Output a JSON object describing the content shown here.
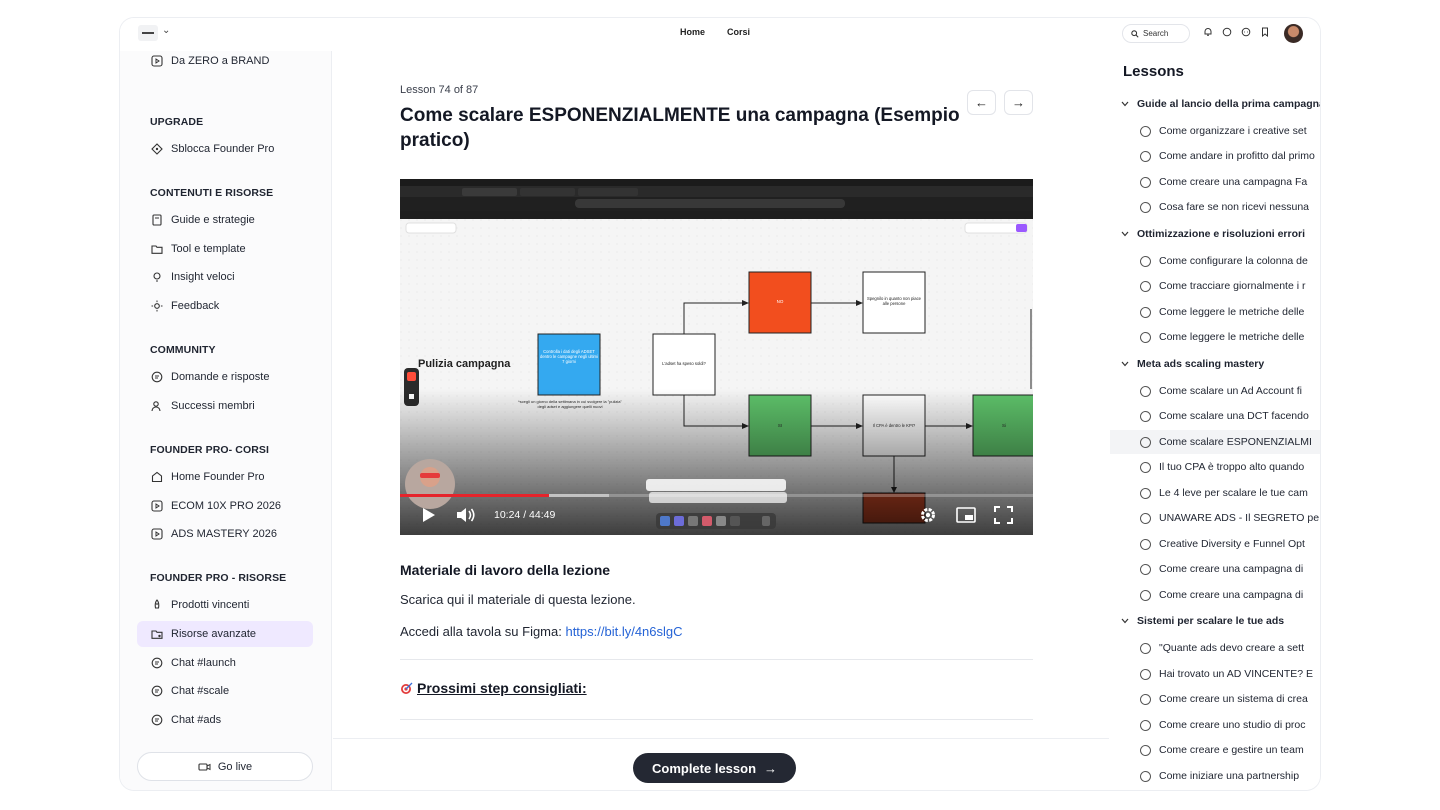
{
  "topbar": {
    "nav": [
      "Home",
      "Corsi"
    ],
    "search_label": "Search"
  },
  "sidebar": {
    "top_item": "Da ZERO a BRAND",
    "sections": [
      {
        "heading": "UPGRADE",
        "items": [
          {
            "label": "Sblocca Founder Pro",
            "icon": "diamond-icon"
          }
        ]
      },
      {
        "heading": "CONTENUTI E RISORSE",
        "items": [
          {
            "label": "Guide e strategie",
            "icon": "book-icon"
          },
          {
            "label": "Tool e template",
            "icon": "folder-icon"
          },
          {
            "label": "Insight veloci",
            "icon": "lightbulb-icon"
          },
          {
            "label": "Feedback",
            "icon": "sun-icon"
          }
        ]
      },
      {
        "heading": "COMMUNITY",
        "items": [
          {
            "label": "Domande e risposte",
            "icon": "chat-icon"
          },
          {
            "label": "Successi membri",
            "icon": "user-icon"
          }
        ]
      },
      {
        "heading": "FOUNDER PRO- CORSI",
        "items": [
          {
            "label": "Home Founder Pro",
            "icon": "home-icon"
          },
          {
            "label": "ECOM 10X PRO 2026",
            "icon": "play-square-icon"
          },
          {
            "label": "ADS MASTERY 2026",
            "icon": "play-square-icon"
          }
        ]
      },
      {
        "heading": "FOUNDER PRO - RISORSE",
        "items": [
          {
            "label": "Prodotti vincenti",
            "icon": "rocket-icon"
          },
          {
            "label": "Risorse avanzate",
            "icon": "folder-user-icon"
          },
          {
            "label": "Chat #launch",
            "icon": "chat-icon"
          },
          {
            "label": "Chat #scale",
            "icon": "chat-icon"
          },
          {
            "label": "Chat #ads",
            "icon": "chat-icon"
          }
        ]
      }
    ],
    "go_live": "Go live"
  },
  "main": {
    "lesson_count": "Lesson 74 of 87",
    "title": "Come scalare ESPONENZIALMENTE una campagna (Esempio pratico)",
    "video": {
      "time": "10:24 / 44:49",
      "progress": 0.235,
      "buffer": 0.33,
      "canvas_label": "Pulizia campagna",
      "node_blue": "Controlla i dati degli ADSET dentro le campagne negli ultimi 7 giorni",
      "node_note": "*scegli un giorno della settimana in cui svolgere la \"pulizia\" degli adset e aggiungere quelli nuovi",
      "node_question": "L'adset ha speso soldi?",
      "node_no": "NO",
      "node_yes": "SI",
      "node_explain": "Spegnilo in quanto non piace alle persone",
      "node_cpa": "Il CPA è dentro le KPI?",
      "node_si2": "Si"
    },
    "material_heading": "Materiale di lavoro della lezione",
    "download_text": "Scarica qui il materiale di questa lezione.",
    "figma_prefix": "Accedi alla tavola su Figma: ",
    "figma_link": "https://bit.ly/4n6slgC",
    "next_steps": "Prossimi step consigliati:",
    "complete_button": "Complete lesson"
  },
  "lessons": {
    "title": "Lessons",
    "sections": [
      {
        "title": "Guide al lancio della prima campagna",
        "items": [
          "Come organizzare i creative set",
          "Come andare in profitto dal primo",
          "Come creare una campagna Fa",
          "Cosa fare se non ricevi nessuna"
        ]
      },
      {
        "title": "Ottimizzazione e risoluzioni errori",
        "items": [
          "Come configurare la colonna de",
          "Come tracciare giornalmente i r",
          "Come leggere le metriche delle",
          "Come leggere le metriche delle"
        ]
      },
      {
        "title": "Meta ads scaling mastery",
        "items": [
          "Come scalare un Ad Account fi",
          "Come scalare una DCT facendo",
          "Come scalare ESPONENZIALMI",
          "Il tuo CPA è troppo alto quando",
          "Le 4 leve per scalare le tue cam",
          "UNAWARE ADS - Il SEGRETO pe",
          "Creative Diversity e Funnel Opt",
          "Come creare una campagna di",
          "Come creare una campagna di"
        ]
      },
      {
        "title": "Sistemi per scalare le tue ads",
        "items": [
          "\"Quante ads devo creare a sett",
          "Hai trovato un AD VINCENTE? E",
          "Come creare un sistema di crea",
          "Come creare uno studio di proc",
          "Come creare e gestire un team",
          "Come iniziare una partnership"
        ]
      }
    ]
  },
  "colors": {
    "accent": "#efe9ff",
    "dark_button": "#242833",
    "progress": "#e5242b",
    "node_orange": "#f24e1e",
    "node_blue": "#34a9f0",
    "node_green": "#5ec26a",
    "link": "#2563d6"
  }
}
